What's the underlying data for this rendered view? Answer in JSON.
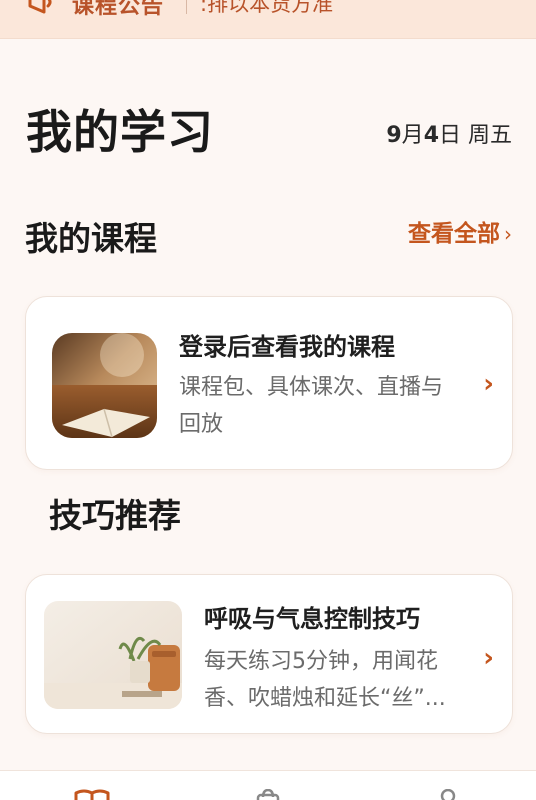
{
  "notice": {
    "label": "课程公告",
    "text": ":排以本货方准"
  },
  "header": {
    "title": "我的学习",
    "date_prefix": "9",
    "date_month": "月",
    "date_day": "4",
    "date_suffix": "日 周五"
  },
  "my_courses": {
    "title": "我的课程",
    "view_all": "查看全部",
    "card": {
      "title": "登录后查看我的课程",
      "desc": "课程包、具体课次、直播与回放"
    }
  },
  "tips": {
    "title": "技巧推荐",
    "card": {
      "title": "呼吸与气息控制技巧",
      "desc": "每天练习5分钟，用闻花香、吹蜡烛和延长“丝”..."
    }
  },
  "colors": {
    "accent": "#c4561e",
    "background": "#fdf7f4",
    "notice_bg": "#fbe7da"
  },
  "icons": {
    "notice": "megaphone-icon",
    "arrow": "chevron-right-icon",
    "tab_study": "book-icon",
    "tab_shop": "bag-icon",
    "tab_profile": "user-icon"
  }
}
